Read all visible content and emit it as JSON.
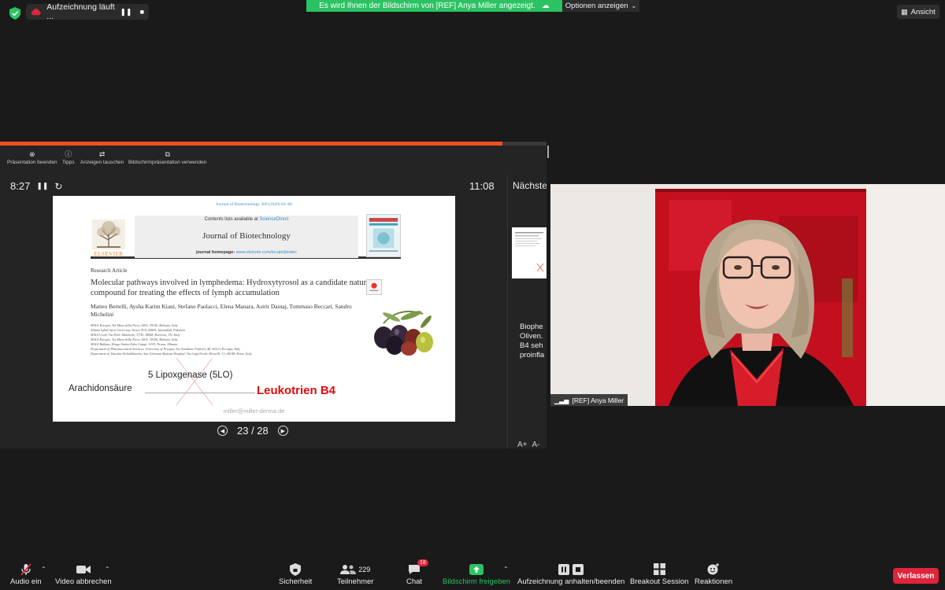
{
  "topbar": {
    "recording_label": "Aufzeichnung läuft ...",
    "share_banner": "Es wird Ihnen der Bildschirm von [REF] Anya Miller angezeigt.",
    "options_label": "Optionen anzeigen",
    "view_label": "Ansicht"
  },
  "presenter": {
    "progress": 0.92,
    "tools": [
      {
        "label": "Präsentation beenden",
        "icon": "close-circle-icon"
      },
      {
        "label": "Tipps",
        "icon": "info-icon"
      },
      {
        "label": "Anzeigen tauschen",
        "icon": "swap-icon"
      },
      {
        "label": "Bildschirmpräsentation verwenden",
        "icon": "screens-icon"
      }
    ],
    "elapsed": "8:27",
    "clock": "11:08",
    "next_label": "Nächste",
    "notes_lines": [
      "Biophe",
      "Oliven.",
      "B4 seh",
      "proinfla"
    ],
    "slide_counter": "23 / 28",
    "font_controls": [
      "A+",
      "A-"
    ]
  },
  "slide": {
    "journal_cite": "Journal of Biotechnology 309 (2020) 82–86",
    "contents_prefix": "Contents lists available at",
    "contents_link": "ScienceDirect",
    "journal_name": "Journal of Biotechnology",
    "homepage_prefix": "journal homepage:",
    "homepage_url": "www.elsevier.com/locate/jbiotec",
    "publisher": "ELSEVIER",
    "article_type": "Research Article",
    "article_title": "Molecular pathways involved in lymphedema: Hydroxytyrosol as a candidate natural compound for treating the effects of lymph accumulation",
    "authors": "Matteo Bertelli, Aysha Karim Kiani, Stefano Paolacci, Elena Manara, Astrit Dautaj, Tommaso Beccari, Sandro Michelini",
    "affiliations": [
      "MAGI Euregio, Via Maso della Pieve, 60/A, 39100, Bolzano, Italy",
      "Allama Iqbal Open University, Sector H-8, 44000, Islamabad, Pakistan",
      "MAGI's Lab, Via Delle Maioliche, 57/D, 38068, Rovereto, TN, Italy",
      "MAGI Euregio, Via Maso della Pieve, 60/A, 39100, Bolzano, Italy",
      "MAGI Balkans, Rruga Andon Zako Cajupi, 1019, Tirana, Albania",
      "Department of Pharmaceutical Sciences, University of Perugia, Via Artoldone Fabretti, 48, 06123, Perugia, Italy",
      "Department of Vascular Rehabilitation, San Giovanni Battista Hospital, Via Luigi Ercole Morselli, 13, 00148, Rome, Italy"
    ],
    "substrate": "Arachidonsäure",
    "enzyme": "5 Lipoxgenase (5LO)",
    "product": "Leukotrien B4",
    "email": "miller@miller-derma.de"
  },
  "video": {
    "participant_name": "[REF] Anya Miller"
  },
  "toolbar": {
    "audio": "Audio ein",
    "video": "Video abbrechen",
    "security": "Sicherheit",
    "participants_count": "229",
    "participants": "Teilnehmer",
    "chat_badge": "18",
    "chat": "Chat",
    "share": "Bildschirm freigeben",
    "recording": "Aufzeichnung anhalten/beenden",
    "breakout": "Breakout Session",
    "reactions": "Reaktionen",
    "leave": "Verlassen"
  },
  "colors": {
    "share_green": "#2bc262",
    "progress_orange": "#f0501e",
    "leave_red": "#e0243b",
    "product_red": "#e30b0b",
    "link_blue": "#3a8fc2"
  }
}
